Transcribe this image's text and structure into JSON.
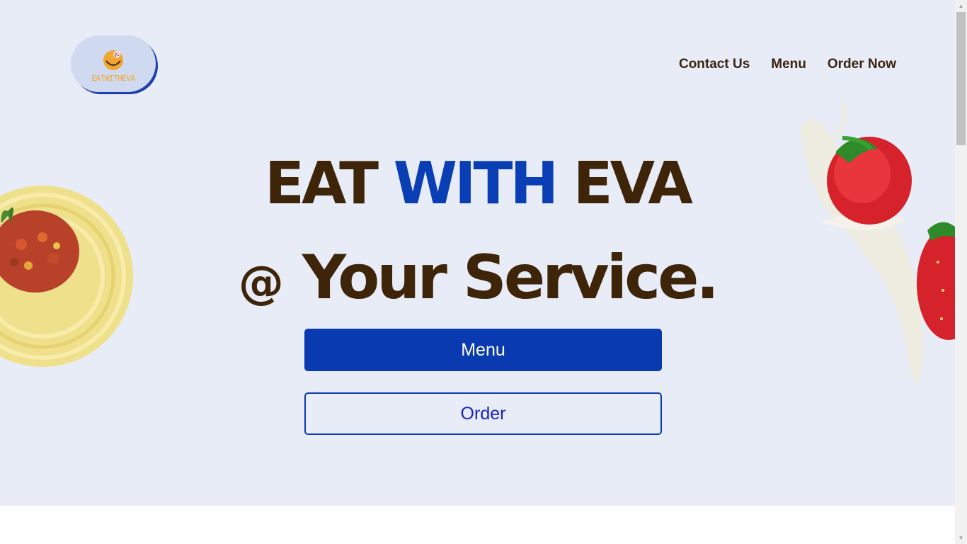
{
  "logo": {
    "text": "EATWITHEVA"
  },
  "nav": {
    "items": [
      {
        "label": "Contact Us"
      },
      {
        "label": "Menu"
      },
      {
        "label": "Order Now"
      }
    ]
  },
  "hero": {
    "headline_line1_part1": "EAT ",
    "headline_line1_accent": "WITH",
    "headline_line1_part2": " EVA",
    "headline_line2_at": "@",
    "headline_line2_text": " Your Service.",
    "menu_button": "Menu",
    "order_button": "Order"
  },
  "colors": {
    "hero_background": "#e8ecf6",
    "brand_blue": "#0a3ab0",
    "headline_brown": "#3e2509",
    "nav_text": "#3b2410"
  },
  "icons": {
    "logo": "eatwitheva-logo-icon",
    "pasta": "spaghetti-bolognese-image",
    "berry": "strawberry-milk-splash-image"
  }
}
